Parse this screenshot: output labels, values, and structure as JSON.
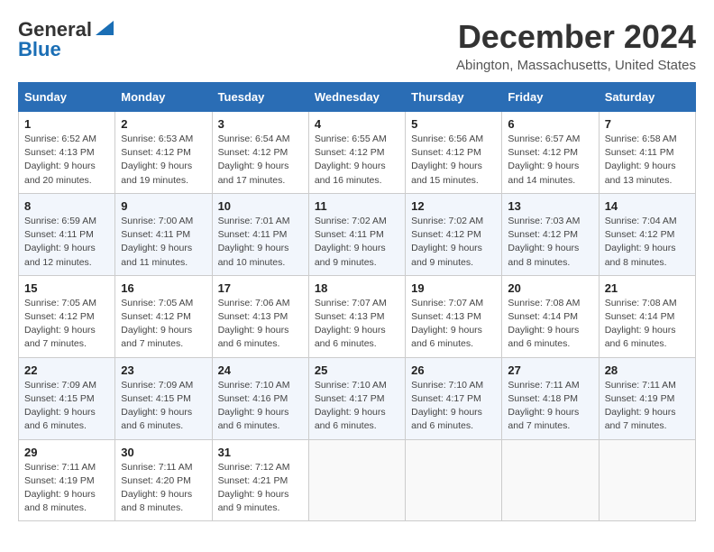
{
  "header": {
    "logo_line1": "General",
    "logo_line2": "Blue",
    "title": "December 2024",
    "subtitle": "Abington, Massachusetts, United States"
  },
  "columns": [
    "Sunday",
    "Monday",
    "Tuesday",
    "Wednesday",
    "Thursday",
    "Friday",
    "Saturday"
  ],
  "weeks": [
    [
      {
        "day": "1",
        "info": "Sunrise: 6:52 AM\nSunset: 4:13 PM\nDaylight: 9 hours\nand 20 minutes."
      },
      {
        "day": "2",
        "info": "Sunrise: 6:53 AM\nSunset: 4:12 PM\nDaylight: 9 hours\nand 19 minutes."
      },
      {
        "day": "3",
        "info": "Sunrise: 6:54 AM\nSunset: 4:12 PM\nDaylight: 9 hours\nand 17 minutes."
      },
      {
        "day": "4",
        "info": "Sunrise: 6:55 AM\nSunset: 4:12 PM\nDaylight: 9 hours\nand 16 minutes."
      },
      {
        "day": "5",
        "info": "Sunrise: 6:56 AM\nSunset: 4:12 PM\nDaylight: 9 hours\nand 15 minutes."
      },
      {
        "day": "6",
        "info": "Sunrise: 6:57 AM\nSunset: 4:12 PM\nDaylight: 9 hours\nand 14 minutes."
      },
      {
        "day": "7",
        "info": "Sunrise: 6:58 AM\nSunset: 4:11 PM\nDaylight: 9 hours\nand 13 minutes."
      }
    ],
    [
      {
        "day": "8",
        "info": "Sunrise: 6:59 AM\nSunset: 4:11 PM\nDaylight: 9 hours\nand 12 minutes."
      },
      {
        "day": "9",
        "info": "Sunrise: 7:00 AM\nSunset: 4:11 PM\nDaylight: 9 hours\nand 11 minutes."
      },
      {
        "day": "10",
        "info": "Sunrise: 7:01 AM\nSunset: 4:11 PM\nDaylight: 9 hours\nand 10 minutes."
      },
      {
        "day": "11",
        "info": "Sunrise: 7:02 AM\nSunset: 4:11 PM\nDaylight: 9 hours\nand 9 minutes."
      },
      {
        "day": "12",
        "info": "Sunrise: 7:02 AM\nSunset: 4:12 PM\nDaylight: 9 hours\nand 9 minutes."
      },
      {
        "day": "13",
        "info": "Sunrise: 7:03 AM\nSunset: 4:12 PM\nDaylight: 9 hours\nand 8 minutes."
      },
      {
        "day": "14",
        "info": "Sunrise: 7:04 AM\nSunset: 4:12 PM\nDaylight: 9 hours\nand 8 minutes."
      }
    ],
    [
      {
        "day": "15",
        "info": "Sunrise: 7:05 AM\nSunset: 4:12 PM\nDaylight: 9 hours\nand 7 minutes."
      },
      {
        "day": "16",
        "info": "Sunrise: 7:05 AM\nSunset: 4:12 PM\nDaylight: 9 hours\nand 7 minutes."
      },
      {
        "day": "17",
        "info": "Sunrise: 7:06 AM\nSunset: 4:13 PM\nDaylight: 9 hours\nand 6 minutes."
      },
      {
        "day": "18",
        "info": "Sunrise: 7:07 AM\nSunset: 4:13 PM\nDaylight: 9 hours\nand 6 minutes."
      },
      {
        "day": "19",
        "info": "Sunrise: 7:07 AM\nSunset: 4:13 PM\nDaylight: 9 hours\nand 6 minutes."
      },
      {
        "day": "20",
        "info": "Sunrise: 7:08 AM\nSunset: 4:14 PM\nDaylight: 9 hours\nand 6 minutes."
      },
      {
        "day": "21",
        "info": "Sunrise: 7:08 AM\nSunset: 4:14 PM\nDaylight: 9 hours\nand 6 minutes."
      }
    ],
    [
      {
        "day": "22",
        "info": "Sunrise: 7:09 AM\nSunset: 4:15 PM\nDaylight: 9 hours\nand 6 minutes."
      },
      {
        "day": "23",
        "info": "Sunrise: 7:09 AM\nSunset: 4:15 PM\nDaylight: 9 hours\nand 6 minutes."
      },
      {
        "day": "24",
        "info": "Sunrise: 7:10 AM\nSunset: 4:16 PM\nDaylight: 9 hours\nand 6 minutes."
      },
      {
        "day": "25",
        "info": "Sunrise: 7:10 AM\nSunset: 4:17 PM\nDaylight: 9 hours\nand 6 minutes."
      },
      {
        "day": "26",
        "info": "Sunrise: 7:10 AM\nSunset: 4:17 PM\nDaylight: 9 hours\nand 6 minutes."
      },
      {
        "day": "27",
        "info": "Sunrise: 7:11 AM\nSunset: 4:18 PM\nDaylight: 9 hours\nand 7 minutes."
      },
      {
        "day": "28",
        "info": "Sunrise: 7:11 AM\nSunset: 4:19 PM\nDaylight: 9 hours\nand 7 minutes."
      }
    ],
    [
      {
        "day": "29",
        "info": "Sunrise: 7:11 AM\nSunset: 4:19 PM\nDaylight: 9 hours\nand 8 minutes."
      },
      {
        "day": "30",
        "info": "Sunrise: 7:11 AM\nSunset: 4:20 PM\nDaylight: 9 hours\nand 8 minutes."
      },
      {
        "day": "31",
        "info": "Sunrise: 7:12 AM\nSunset: 4:21 PM\nDaylight: 9 hours\nand 9 minutes."
      },
      {
        "day": "",
        "info": ""
      },
      {
        "day": "",
        "info": ""
      },
      {
        "day": "",
        "info": ""
      },
      {
        "day": "",
        "info": ""
      }
    ]
  ]
}
